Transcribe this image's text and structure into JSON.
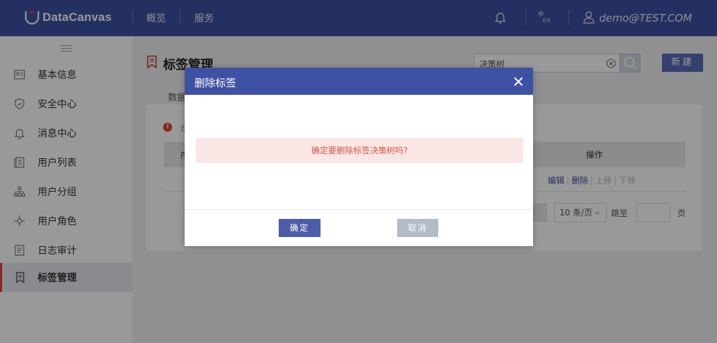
{
  "app": {
    "logo_text": "DataCanvas",
    "nav": [
      "概览",
      "服务"
    ],
    "lang_top": "中",
    "lang_bottom": "EN",
    "user": "demo@TEST.COM"
  },
  "sidebar": {
    "items": [
      {
        "label": "基本信息",
        "icon": "id-card-icon"
      },
      {
        "label": "安全中心",
        "icon": "shield-icon"
      },
      {
        "label": "消息中心",
        "icon": "bell-icon"
      },
      {
        "label": "用户列表",
        "icon": "user-list-icon"
      },
      {
        "label": "用户分组",
        "icon": "org-tree-icon"
      },
      {
        "label": "用户角色",
        "icon": "role-icon"
      },
      {
        "label": "日志审计",
        "icon": "log-icon"
      },
      {
        "label": "标签管理",
        "icon": "bookmark-icon",
        "active": true
      }
    ]
  },
  "main": {
    "title": "标签管理",
    "search_value": "决策树",
    "new_button": "新建",
    "tab": "数据",
    "warn_char": "!",
    "warn_text": "た",
    "table_first_header": "序",
    "table_ops_header": "操作",
    "row_ops": {
      "edit": "编辑",
      "delete": "删除",
      "up": "上移",
      "down": "下移"
    },
    "pagination": {
      "page_size": "10 条/页",
      "jump": "跳至",
      "page": "页"
    }
  },
  "modal": {
    "title": "删除标签",
    "message": "确定要删除标签决策树吗?",
    "ok": "确定",
    "cancel": "取消"
  },
  "colors": {
    "header": "#3f51a3",
    "accent": "#e0453a",
    "ok_button": "#4d5ea8",
    "cancel_button": "#b3bac8",
    "message_bg": "#f9e6e5",
    "message_text": "#d05a4a"
  }
}
